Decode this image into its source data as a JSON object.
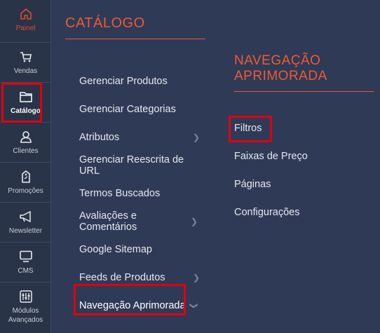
{
  "rail": {
    "items": [
      {
        "label": "Painel",
        "icon": "home-icon"
      },
      {
        "label": "Vendas",
        "icon": "cart-icon"
      },
      {
        "label": "Catálogo",
        "icon": "folder-icon"
      },
      {
        "label": "Clientes",
        "icon": "user-icon"
      },
      {
        "label": "Promoções",
        "icon": "tag-icon"
      },
      {
        "label": "Newsletter",
        "icon": "megaphone-icon"
      },
      {
        "label": "CMS",
        "icon": "monitor-icon"
      },
      {
        "label": "Módulos Avançados",
        "icon": "sliders-icon"
      }
    ]
  },
  "catalog": {
    "title": "CATÁLOGO",
    "items": [
      {
        "label": "Gerenciar Produtos"
      },
      {
        "label": "Gerenciar Categorias"
      },
      {
        "label": "Atributos"
      },
      {
        "label": "Gerenciar Reescrita de URL"
      },
      {
        "label": "Termos Buscados"
      },
      {
        "label": "Avaliações e Comentários"
      },
      {
        "label": "Google Sitemap"
      },
      {
        "label": "Feeds de Produtos"
      },
      {
        "label": "Navegação Aprimorada"
      }
    ]
  },
  "submenu": {
    "title": "NAVEGAÇÃO APRIMORADA",
    "items": [
      {
        "label": "Filtros"
      },
      {
        "label": "Faixas de Preço"
      },
      {
        "label": "Páginas"
      },
      {
        "label": "Configurações"
      }
    ]
  },
  "colors": {
    "accent": "#ee5a33",
    "highlight": "#e0000f",
    "background": "#2f3a56"
  }
}
